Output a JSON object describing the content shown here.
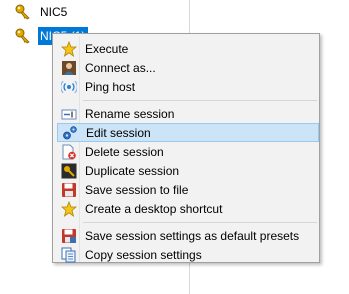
{
  "sessions": [
    {
      "label": "NIC5",
      "icon": "key-icon",
      "selected": false
    },
    {
      "label": "NIC5 (1)",
      "icon": "key-icon",
      "selected": true
    }
  ],
  "menu": {
    "groups": [
      [
        {
          "label": "Execute",
          "icon": "star-icon"
        },
        {
          "label": "Connect as...",
          "icon": "user-icon"
        },
        {
          "label": "Ping host",
          "icon": "ping-icon"
        }
      ],
      [
        {
          "label": "Rename session",
          "icon": "rename-icon"
        },
        {
          "label": "Edit session",
          "icon": "gears-icon",
          "highlighted": true
        },
        {
          "label": "Delete session",
          "icon": "delete-icon"
        },
        {
          "label": "Duplicate session",
          "icon": "key-icon"
        },
        {
          "label": "Save session to file",
          "icon": "save-icon"
        },
        {
          "label": "Create a desktop shortcut",
          "icon": "star-icon"
        }
      ],
      [
        {
          "label": "Save session settings as default presets",
          "icon": "save-red-icon"
        },
        {
          "label": "Copy session settings",
          "icon": "copy-icon"
        }
      ]
    ]
  },
  "colors": {
    "selection": "#0078d7",
    "highlight": "#cce4f7",
    "menu_bg": "#f2f2f2"
  }
}
